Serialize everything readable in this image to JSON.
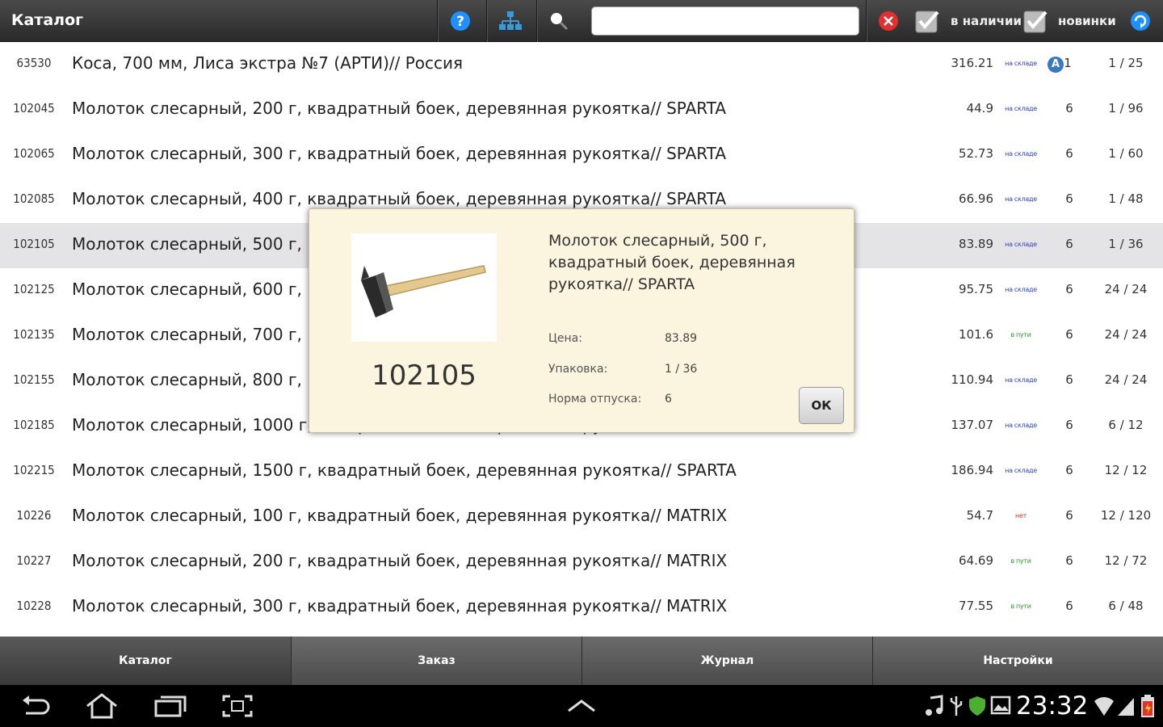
{
  "header": {
    "title": "Каталог",
    "in_stock_label": "в наличии",
    "new_label": "новинки",
    "search_value": "",
    "colors": {
      "bar": "#333333",
      "help": "#1e90ff",
      "clear": "#e03030",
      "refresh": "#1e90ff"
    }
  },
  "rows": [
    {
      "code": "63530",
      "name": "Коса, 700 мм,  Лиса экстра №7 (АРТИ)// Россия",
      "price": "316.21",
      "stock": "на складе",
      "stock_color": "#2a3fbf",
      "badge": "A",
      "norm": "1",
      "pack": "1 / 25"
    },
    {
      "code": "102045",
      "name": "Молоток слесарный, 200 г, квадратный боек, деревянная рукоятка// SPARTA",
      "price": "44.9",
      "stock": "на складе",
      "stock_color": "#2a3fbf",
      "norm": "6",
      "pack": "1 / 96"
    },
    {
      "code": "102065",
      "name": "Молоток слесарный, 300 г, квадратный боек, деревянная рукоятка// SPARTA",
      "price": "52.73",
      "stock": "на складе",
      "stock_color": "#2a3fbf",
      "norm": "6",
      "pack": "1 / 60"
    },
    {
      "code": "102085",
      "name": "Молоток слесарный, 400 г, квадратный боек, деревянная рукоятка// SPARTA",
      "price": "66.96",
      "stock": "на складе",
      "stock_color": "#2a3fbf",
      "norm": "6",
      "pack": "1 / 48"
    },
    {
      "code": "102105",
      "name": "Молоток слесарный, 500 г, квадратный боек, деревянная рукоятка// SPARTA",
      "price": "83.89",
      "stock": "на складе",
      "stock_color": "#2a3fbf",
      "norm": "6",
      "pack": "1 / 36",
      "selected": true
    },
    {
      "code": "102125",
      "name": "Молоток слесарный, 600 г, квадратный боек, деревянная рукоятка// SPARTA",
      "price": "95.75",
      "stock": "на складе",
      "stock_color": "#2a3fbf",
      "norm": "6",
      "pack": "24 / 24"
    },
    {
      "code": "102135",
      "name": "Молоток слесарный, 700 г, квадратный боек, деревянная рукоятка// SPARTA",
      "price": "101.6",
      "stock": "в пути",
      "stock_color": "#2a9a2a",
      "norm": "6",
      "pack": "24 / 24"
    },
    {
      "code": "102155",
      "name": "Молоток слесарный, 800 г, квадратный боек, деревянная рукоятка// SPARTA",
      "price": "110.94",
      "stock": "на складе",
      "stock_color": "#2a3fbf",
      "norm": "6",
      "pack": "24 / 24"
    },
    {
      "code": "102185",
      "name": "Молоток слесарный, 1000 г, квадратный боек, деревянная рукоятка// SPARTA",
      "price": "137.07",
      "stock": "на складе",
      "stock_color": "#2a3fbf",
      "norm": "6",
      "pack": "6 / 12"
    },
    {
      "code": "102215",
      "name": "Молоток слесарный, 1500 г, квадратный боек, деревянная рукоятка// SPARTA",
      "price": "186.94",
      "stock": "на складе",
      "stock_color": "#2a3fbf",
      "norm": "6",
      "pack": "12 / 12"
    },
    {
      "code": "10226",
      "name": "Молоток слесарный, 100 г, квадратный боек, деревянная рукоятка// MATRIX",
      "price": "54.7",
      "stock": "нет",
      "stock_color": "#d03030",
      "norm": "6",
      "pack": "12 / 120"
    },
    {
      "code": "10227",
      "name": "Молоток слесарный, 200 г, квадратный боек, деревянная рукоятка// MATRIX",
      "price": "64.69",
      "stock": "в пути",
      "stock_color": "#2a9a2a",
      "norm": "6",
      "pack": "12 / 72"
    },
    {
      "code": "10228",
      "name": "Молоток слесарный, 300 г, квадратный боек, деревянная рукоятка// MATRIX",
      "price": "77.55",
      "stock": "в пути",
      "stock_color": "#2a9a2a",
      "norm": "6",
      "pack": "6 / 48"
    }
  ],
  "popup": {
    "code": "102105",
    "title": "Молоток слесарный, 500 г, квадратный боек, деревянная рукоятка// SPARTA",
    "price_label": "Цена:",
    "price_value": "83.89",
    "pack_label": "Упаковка:",
    "pack_value": "1 / 36",
    "norm_label": "Норма отпуска:",
    "norm_value": "6",
    "ok_label": "ОК"
  },
  "tabs": [
    {
      "label": "Каталог",
      "active": true
    },
    {
      "label": "Заказ",
      "active": false
    },
    {
      "label": "Журнал",
      "active": false
    },
    {
      "label": "Настройки",
      "active": false
    }
  ],
  "status": {
    "time": "23:32"
  }
}
